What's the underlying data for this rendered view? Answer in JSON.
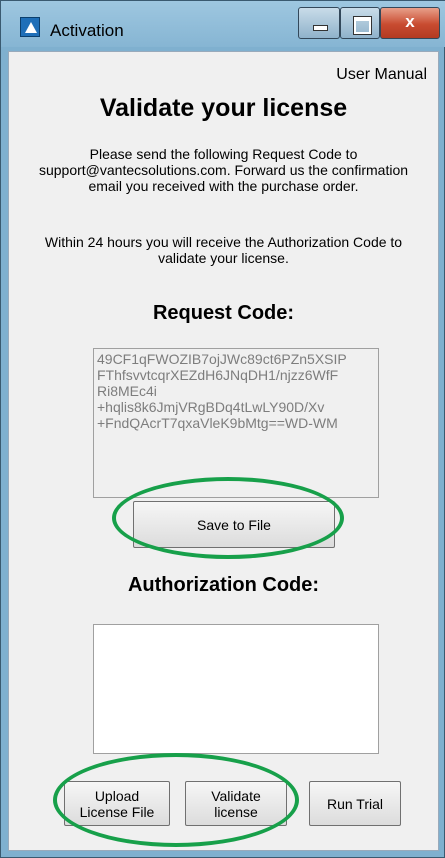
{
  "window": {
    "title": "Activation",
    "minimize_icon": "minimize-icon",
    "maximize_icon": "maximize-icon",
    "close_label": "x"
  },
  "header": {
    "user_manual_link": "User Manual"
  },
  "main": {
    "heading": "Validate your license",
    "instructions": "Please send the following Request Code to support@vantecsolutions.com. Forward us the confirmation email you received with the purchase order.",
    "timeline_note": "Within 24 hours you will receive the Authorization Code to validate your license.",
    "request_code_label": "Request Code:",
    "request_code_value": "49CF1qFWOZIB7ojJWc89ct6PZn5XSIP\nFThfsvvtcqrXEZdH6JNqDH1/njzz6WfF\nRi8MEc4i\n+hqlis8k6JmjVRgBDq4tLwLY90D/Xv\n+FndQAcrT7qxaVleK9bMtg==WD-WM",
    "save_button": "Save to File",
    "authorization_code_label": "Authorization Code:",
    "authorization_code_value": ""
  },
  "footer": {
    "upload_button": "Upload\nLicense File",
    "validate_button": "Validate\nlicense",
    "trial_button": "Run Trial"
  },
  "annotations": {
    "highlight_color": "#17a04a"
  }
}
